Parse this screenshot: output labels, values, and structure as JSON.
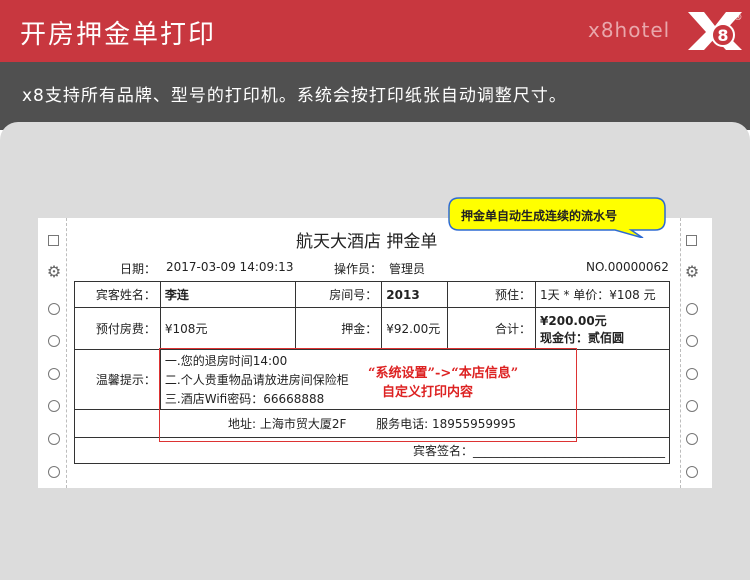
{
  "header": {
    "title": "开房押金单打印",
    "brand": "x8hotel"
  },
  "logo": {
    "text": "X8",
    "mark": "®"
  },
  "description": "x8支持所有品牌、型号的打印机。系统会按打印纸张自动调整尺寸。",
  "bubble": {
    "text": "押金单自动生成连续的流水号"
  },
  "receipt": {
    "title": "航天大酒店 押金单",
    "date_label": "日期：",
    "date_value": "2017-03-09 14:09:13",
    "operator_label": "操作员：",
    "operator_value": "管理员",
    "serial_no": "NO.00000062",
    "rows": {
      "guest_label": "宾客姓名：",
      "guest_value": "李连",
      "room_label": "房间号：",
      "room_value": "2013",
      "stay_label": "预住：",
      "stay_value": "1天 * 单价：¥108 元",
      "prepay_label": "预付房费：",
      "prepay_value": "¥108元",
      "deposit_label": "押金：",
      "deposit_value": "¥92.00元",
      "total_label": "合计：",
      "total_value": "¥200.00元",
      "total_cash": "现金付：贰佰圆"
    },
    "tips_label": "温馨提示：",
    "tips": [
      "一.您的退房时间14:00",
      "二.个人贵重物品请放进房间保险柜",
      "三.酒店Wifi密码：66668888"
    ],
    "address": "地址: 上海市贸大厦2F",
    "phone": "服务电话: 18955959995",
    "signature_label": "宾客签名：",
    "signature_line": "________________________________"
  },
  "annotation": {
    "line1": "“系统设置”->“本店信息”",
    "line2": "自定义打印内容"
  }
}
